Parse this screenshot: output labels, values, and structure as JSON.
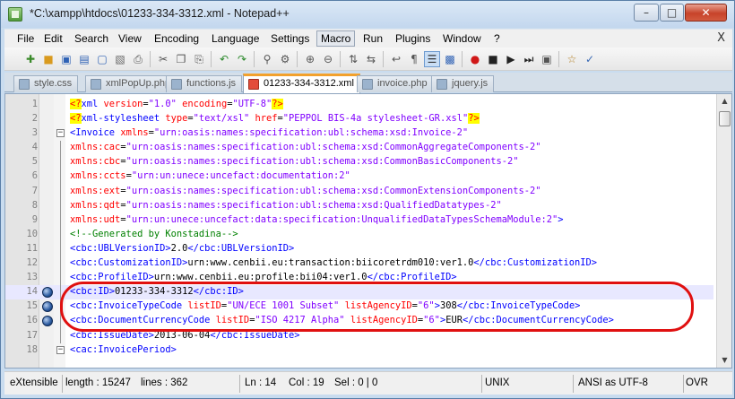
{
  "window": {
    "title": "*C:\\xampp\\htdocs\\01233-334-3312.xml - Notepad++"
  },
  "menu": {
    "items": [
      "File",
      "Edit",
      "Search",
      "View",
      "Encoding",
      "Language",
      "Settings",
      "Macro",
      "Run",
      "Plugins",
      "Window",
      "?"
    ],
    "active": "Macro",
    "close_glyph": "X"
  },
  "tabs": [
    {
      "label": "style.css",
      "active": false
    },
    {
      "label": "xmlPopUp.php",
      "active": false
    },
    {
      "label": "functions.js",
      "active": false
    },
    {
      "label": "01233-334-3312.xml",
      "active": true
    },
    {
      "label": "invoice.php",
      "active": false
    },
    {
      "label": "jquery.js",
      "active": false
    }
  ],
  "editor": {
    "current_line": 14,
    "bookmarked_lines": [
      14,
      15,
      16
    ],
    "lines": [
      {
        "n": "1",
        "segs": [
          [
            "pi",
            "<?"
          ],
          [
            "tag",
            "xml "
          ],
          [
            "attr",
            "version"
          ],
          [
            "text",
            "="
          ],
          [
            "val",
            "\"1.0\""
          ],
          [
            "text",
            " "
          ],
          [
            "attr",
            "encoding"
          ],
          [
            "text",
            "="
          ],
          [
            "val",
            "\"UTF-8\""
          ],
          [
            "pi",
            "?>"
          ]
        ]
      },
      {
        "n": "2",
        "segs": [
          [
            "pi",
            "<?"
          ],
          [
            "tag",
            "xml-stylesheet "
          ],
          [
            "attr",
            "type"
          ],
          [
            "text",
            "="
          ],
          [
            "val",
            "\"text/xsl\""
          ],
          [
            "text",
            " "
          ],
          [
            "attr",
            "href"
          ],
          [
            "text",
            "="
          ],
          [
            "val",
            "\"PEPPOL BIS-4a stylesheet-GR.xsl\""
          ],
          [
            "pi",
            "?>"
          ]
        ]
      },
      {
        "n": "3",
        "fold": "minus",
        "segs": [
          [
            "tag",
            "<Invoice "
          ],
          [
            "attr",
            "xmlns"
          ],
          [
            "text",
            "="
          ],
          [
            "val",
            "\"urn:oasis:names:specification:ubl:schema:xsd:Invoice-2\""
          ]
        ]
      },
      {
        "n": "4",
        "segs": [
          [
            "attr",
            "xmlns:cac"
          ],
          [
            "text",
            "="
          ],
          [
            "val",
            "\"urn:oasis:names:specification:ubl:schema:xsd:CommonAggregateComponents-2\""
          ]
        ]
      },
      {
        "n": "5",
        "segs": [
          [
            "attr",
            "xmlns:cbc"
          ],
          [
            "text",
            "="
          ],
          [
            "val",
            "\"urn:oasis:names:specification:ubl:schema:xsd:CommonBasicComponents-2\""
          ]
        ]
      },
      {
        "n": "6",
        "segs": [
          [
            "attr",
            "xmlns:ccts"
          ],
          [
            "text",
            "="
          ],
          [
            "val",
            "\"urn:un:unece:uncefact:documentation:2\""
          ]
        ]
      },
      {
        "n": "7",
        "segs": [
          [
            "attr",
            "xmlns:ext"
          ],
          [
            "text",
            "="
          ],
          [
            "val",
            "\"urn:oasis:names:specification:ubl:schema:xsd:CommonExtensionComponents-2\""
          ]
        ]
      },
      {
        "n": "8",
        "segs": [
          [
            "attr",
            "xmlns:qdt"
          ],
          [
            "text",
            "="
          ],
          [
            "val",
            "\"urn:oasis:names:specification:ubl:schema:xsd:QualifiedDatatypes-2\""
          ]
        ]
      },
      {
        "n": "9",
        "segs": [
          [
            "attr",
            "xmlns:udt"
          ],
          [
            "text",
            "="
          ],
          [
            "val",
            "\"urn:un:unece:uncefact:data:specification:UnqualifiedDataTypesSchemaModule:2\""
          ],
          [
            "tag",
            ">"
          ]
        ]
      },
      {
        "n": "10",
        "segs": [
          [
            "com",
            "<!--Generated by Konstadina-->"
          ]
        ]
      },
      {
        "n": "11",
        "segs": [
          [
            "tag",
            "<cbc:UBLVersionID>"
          ],
          [
            "text",
            "2.0"
          ],
          [
            "tag",
            "</cbc:UBLVersionID>"
          ]
        ]
      },
      {
        "n": "12",
        "segs": [
          [
            "tag",
            "<cbc:CustomizationID>"
          ],
          [
            "text",
            "urn:www.cenbii.eu:transaction:biicoretrdm010:ver1.0"
          ],
          [
            "tag",
            "</cbc:CustomizationID>"
          ]
        ]
      },
      {
        "n": "13",
        "segs": [
          [
            "tag",
            "<cbc:ProfileID>"
          ],
          [
            "text",
            "urn:www.cenbii.eu:profile:bii04:ver1.0"
          ],
          [
            "tag",
            "</cbc:ProfileID>"
          ]
        ]
      },
      {
        "n": "14",
        "segs": [
          [
            "tag",
            "<cbc:ID>"
          ],
          [
            "text",
            "01233-334-3312"
          ],
          [
            "tag",
            "</cbc:ID>"
          ]
        ]
      },
      {
        "n": "15",
        "segs": [
          [
            "tag",
            "<cbc:InvoiceTypeCode "
          ],
          [
            "attr",
            "listID"
          ],
          [
            "text",
            "="
          ],
          [
            "val",
            "\"UN/ECE 1001 Subset\""
          ],
          [
            "text",
            " "
          ],
          [
            "attr",
            "listAgencyID"
          ],
          [
            "text",
            "="
          ],
          [
            "val",
            "\"6\""
          ],
          [
            "tag",
            ">"
          ],
          [
            "text",
            "308"
          ],
          [
            "tag",
            "</cbc:InvoiceTypeCode>"
          ]
        ]
      },
      {
        "n": "16",
        "segs": [
          [
            "tag",
            "<cbc:DocumentCurrencyCode "
          ],
          [
            "attr",
            "listID"
          ],
          [
            "text",
            "="
          ],
          [
            "val",
            "\"ISO 4217 Alpha\""
          ],
          [
            "text",
            " "
          ],
          [
            "attr",
            "listAgencyID"
          ],
          [
            "text",
            "="
          ],
          [
            "val",
            "\"6\""
          ],
          [
            "tag",
            ">"
          ],
          [
            "text",
            "EUR"
          ],
          [
            "tag",
            "</cbc:DocumentCurrencyCode>"
          ]
        ]
      },
      {
        "n": "17",
        "segs": [
          [
            "tag",
            "<cbc:IssueDate>"
          ],
          [
            "text",
            "2013-06-04"
          ],
          [
            "tag",
            "</cbc:IssueDate>"
          ]
        ]
      },
      {
        "n": "18",
        "fold": "minus",
        "segs": [
          [
            "tag",
            "<cac:InvoicePeriod>"
          ]
        ]
      }
    ]
  },
  "status": {
    "type": "eXtensible",
    "length": "length : 15247",
    "lines": "lines : 362",
    "ln": "Ln : 14",
    "col": "Col : 19",
    "sel": "Sel : 0 | 0",
    "eol": "UNIX",
    "encoding": "ANSI as UTF-8",
    "mode": "OVR"
  },
  "colors": {
    "annotation": "#e01010",
    "active_tab_accent": "#f2a12d",
    "current_line_bg": "#e8e8ff"
  }
}
